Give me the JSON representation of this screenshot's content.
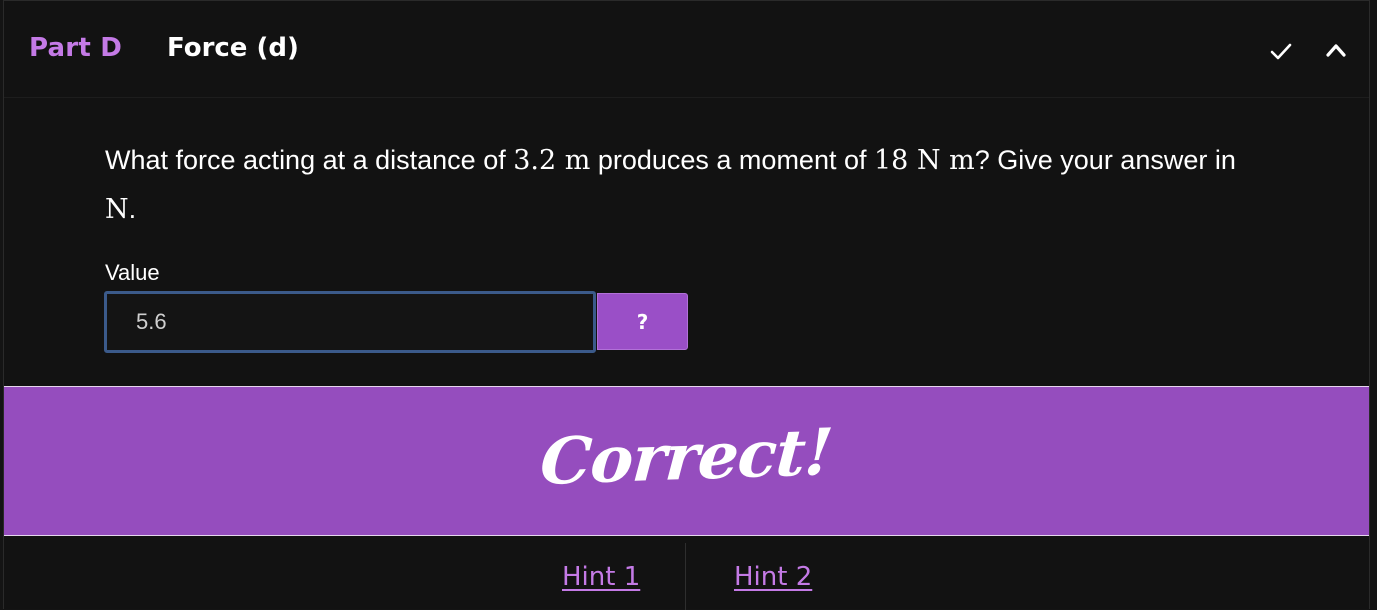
{
  "header": {
    "part_label": "Part D",
    "title": "Force (d)",
    "icons": [
      "check-icon",
      "chevron-up-icon"
    ]
  },
  "question": {
    "text_1": "What force acting at a distance of ",
    "math_1": "3.2 m",
    "text_2": " produces a moment of ",
    "math_2": "18 N m",
    "text_3": "? Give your answer in ",
    "math_3": "N",
    "text_4": "."
  },
  "answer": {
    "label": "Value",
    "value": "5.6",
    "help_label": "?"
  },
  "feedback": {
    "text": "Correct!"
  },
  "hints": [
    {
      "label": "Hint 1"
    },
    {
      "label": "Hint 2"
    }
  ],
  "colors": {
    "accent": "#c47ae6",
    "banner": "#954dbe",
    "button": "#9a4fc7",
    "input_border": "#3b5a8a",
    "background": "#121212"
  }
}
